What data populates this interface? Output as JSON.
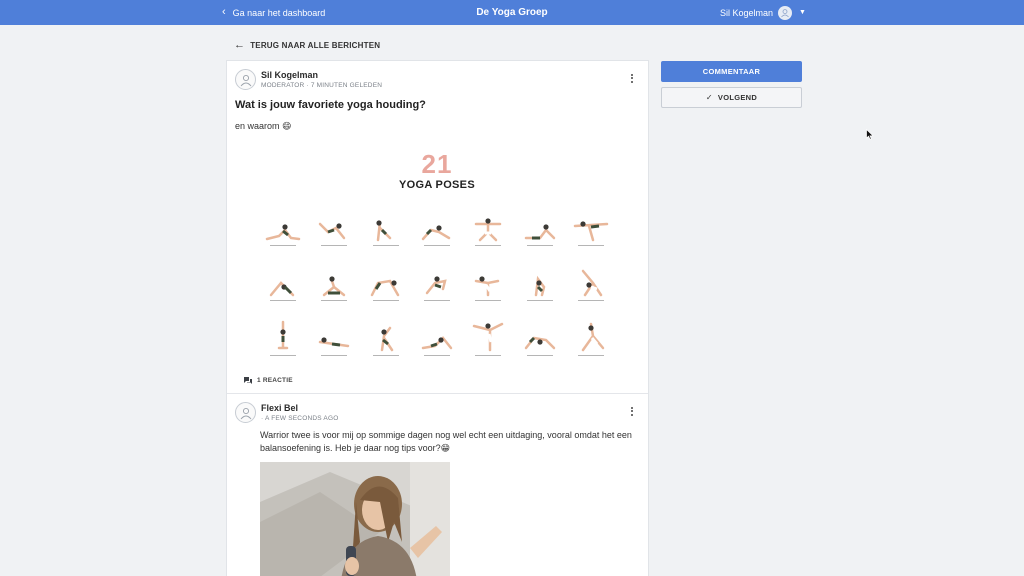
{
  "header": {
    "back_label": "Ga naar het dashboard",
    "group_title": "De Yoga Groep",
    "user_name": "Sil Kogelman"
  },
  "nav": {
    "back_to_all": "TERUG NAAR ALLE BERICHTEN"
  },
  "post": {
    "author": "Sil Kogelman",
    "meta": "MODERATOR · 7 MINUTEN GELEDEN",
    "title": "Wat is jouw favoriete yoga houding?",
    "body": "en waarom 😄",
    "image": {
      "number": "21",
      "title": "YOGA POSES"
    },
    "reactions": "1 REACTIE"
  },
  "comment": {
    "author": "Flexi Bel",
    "meta": "· A FEW SECONDS AGO",
    "text": "Warrior twee is voor mij op sommige dagen nog wel echt een uitdaging, vooral omdat het een balansoefening is. Heb je daar nog tips voor?😁"
  },
  "sidebar": {
    "comment_button": "COMMENTAAR",
    "follow_button": "VOLGEND"
  },
  "colors": {
    "accent": "#4f7fd9",
    "poster_number": "#e9a79d",
    "background": "#f0f2f4"
  },
  "icons": [
    "chevron-left-icon",
    "arrow-left-icon",
    "user-avatar-icon",
    "caret-down-icon",
    "kebab-menu-icon",
    "chat-bubbles-icon",
    "check-icon",
    "mouse-cursor-icon"
  ]
}
